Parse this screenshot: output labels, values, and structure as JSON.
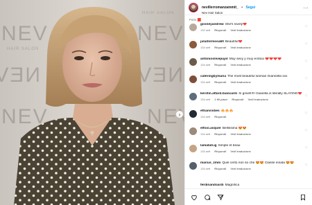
{
  "header": {
    "username": "nevillerromanzammit_",
    "separator": "•",
    "follow_label": "Segui",
    "subtitle": "Nev Hair Salon",
    "more_label": "..."
  },
  "comments_top_partial": "Paris 🟥",
  "comments": [
    {
      "user": "gosneyandrew",
      "text": "She's lovely❤️",
      "time": "132 sett",
      "actions": [
        "Rispondi",
        "Vedi traduzione"
      ],
      "avatar_color": "#b8a99a"
    },
    {
      "user": "juliaformosa60",
      "text": "Beautiful❤️",
      "time": "134 sett",
      "actions": [
        "Rispondi",
        "Vedi traduzione"
      ],
      "avatar_color": "#8c5a3c"
    },
    {
      "user": "antonioolivepujol",
      "text": "Muy sexy y muy erótica ❤️❤️❤️❤️",
      "time": "134 sett",
      "actions": [
        "Rispondi",
        "Vedi traduzione"
      ],
      "avatar_color": "#6b5b4b"
    },
    {
      "user": "cateringbymaria",
      "text": "The most beautiful woman Giannella xxx",
      "time": "134 sett",
      "actions": [
        "Rispondi",
        "Vedi traduzione"
      ],
      "avatar_color": "#7d4f3a"
    },
    {
      "user": "kerstin.attard.biancardi",
      "text": "Xi gmiel!!!!! Gianella is literally SLAYING❤️",
      "time": "134 sett",
      "actions": [
        "1 Mi piace",
        "Rispondi",
        "Vedi traduzione"
      ],
      "avatar_color": "#5f6d7a",
      "wrap": true
    },
    {
      "user": "ethanvvibes",
      "text": "🔥🔥🔥",
      "time": "134 sett",
      "actions": [
        "Rispondi"
      ],
      "avatar_color": "#222a33"
    },
    {
      "user": "elfoio.asquer",
      "text": "Bellissima 😍😍",
      "time": "134 sett",
      "actions": [
        "Rispondi",
        "Vedi traduzione"
      ],
      "avatar_color": "#9a8a7a"
    },
    {
      "user": "lamatall.ig",
      "text": "Simple et beau",
      "time": "134 sett",
      "actions": [
        "Rispondi",
        "Vedi traduzione"
      ],
      "avatar_color": "#c4a484"
    },
    {
      "user": "marius_zmm",
      "text": "Quel certo non so che 😍😍 Classe innata 😍😍",
      "time": "134 sett",
      "actions": [
        "Rispondi",
        "Vedi traduzione"
      ],
      "avatar_color": "#54606b"
    }
  ],
  "last_comment": {
    "user": "ferdinandoardi",
    "text": "Magnifica"
  },
  "actions": {
    "like_icon": "heart-icon",
    "comment_icon": "comment-icon",
    "share_icon": "share-icon",
    "save_icon": "bookmark-icon"
  },
  "photo": {
    "wall_text_large": "NEV",
    "wall_text_small": "HAIR SALON"
  },
  "colors": {
    "follow_blue": "#0095f6",
    "muted": "#737373",
    "border": "#efefef"
  }
}
